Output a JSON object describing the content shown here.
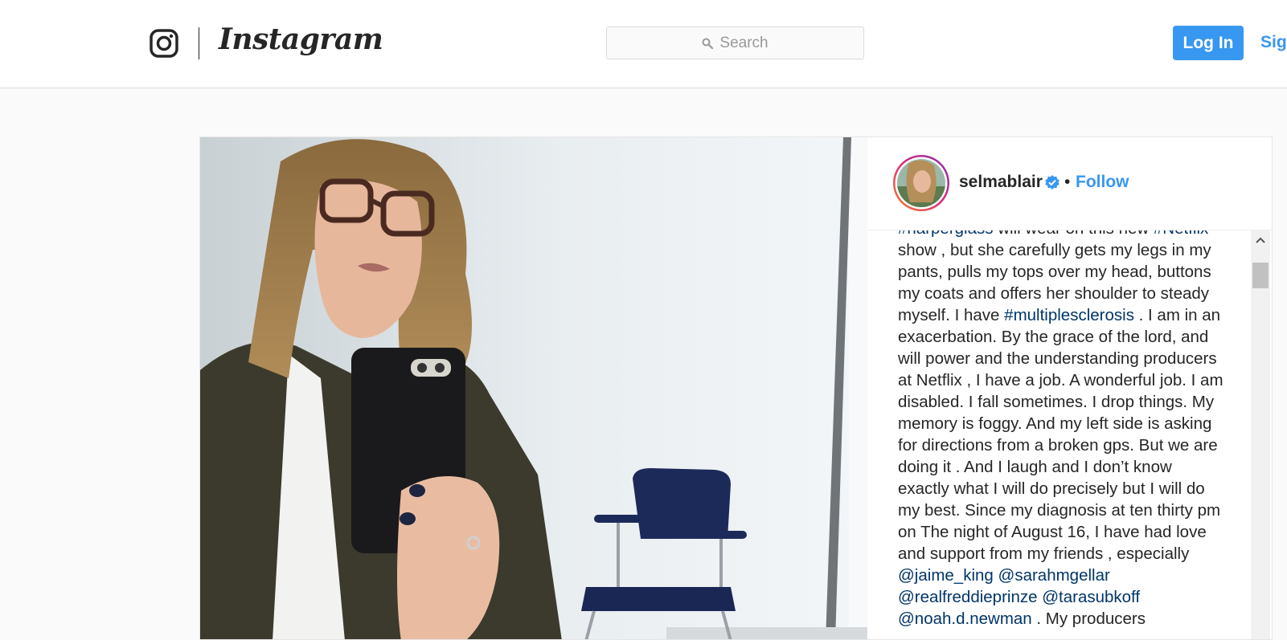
{
  "header": {
    "brand_name": "Instagram",
    "search_placeholder": "Search",
    "login_label": "Log In",
    "signup_label": "Sign Up"
  },
  "post": {
    "username": "selmablair",
    "separator": "•",
    "follow_label": "Follow",
    "caption": [
      {
        "text": "#harperglass",
        "tag": true
      },
      {
        "text": " will wear on this new ",
        "tag": false
      },
      {
        "text": "#Netflix",
        "tag": true
      },
      {
        "text": " show , but she carefully gets my legs in my pants, pulls my tops over my head, buttons my coats and offers her shoulder to steady myself. I have ",
        "tag": false
      },
      {
        "text": "#multiplesclerosis",
        "tag": true
      },
      {
        "text": " . I am in an exacerbation. By the grace of the lord, and will power and the understanding producers at Netflix , I have a job. A wonderful job. I am disabled. I fall sometimes. I drop things. My memory is foggy. And my left side is asking for directions from a broken gps. But we are doing it . And I laugh and I don’t know exactly what I will do precisely but I will do my best. Since my diagnosis at ten thirty pm on The night of August 16, I have had love and support from my friends , especially ",
        "tag": false
      },
      {
        "text": "@jaime_king",
        "tag": true
      },
      {
        "text": " ",
        "tag": false
      },
      {
        "text": "@sarahmgellar",
        "tag": true
      },
      {
        "text": " ",
        "tag": false
      },
      {
        "text": "@realfreddieprinze",
        "tag": true
      },
      {
        "text": " ",
        "tag": false
      },
      {
        "text": "@tarasubkoff",
        "tag": true
      },
      {
        "text": " ",
        "tag": false
      },
      {
        "text": "@noah.d.newman",
        "tag": true
      },
      {
        "text": " . My producers",
        "tag": false
      }
    ]
  },
  "colors": {
    "accent": "#3897f0",
    "hashtag": "#003569",
    "text": "#262626"
  },
  "icons": {
    "logo": "instagram-glyph-icon",
    "search": "search-icon",
    "verified": "verified-badge-icon",
    "scroll_up": "arrow-up-icon"
  }
}
